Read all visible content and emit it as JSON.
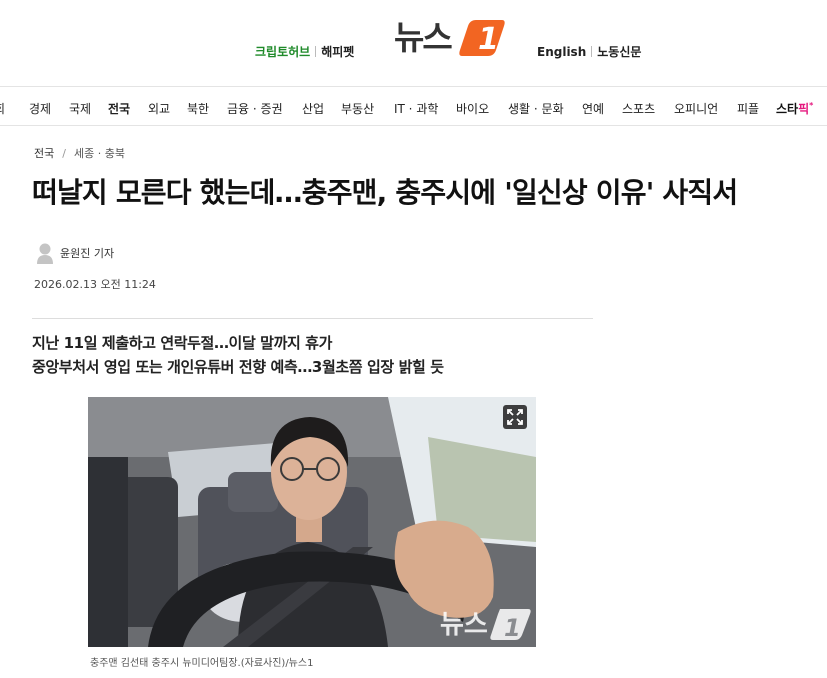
{
  "header": {
    "left_links": [
      "크립토허브",
      "해피펫"
    ],
    "logo_text": "뉴스",
    "logo_mark": "1",
    "right_links": [
      "English",
      "노동신문"
    ],
    "brand_color": "#f26522"
  },
  "nav": {
    "items": [
      {
        "label": "회",
        "active": false
      },
      {
        "label": "경제",
        "active": false
      },
      {
        "label": "국제",
        "active": false
      },
      {
        "label": "전국",
        "active": true
      },
      {
        "label": "외교",
        "active": false
      },
      {
        "label": "북한",
        "active": false
      },
      {
        "label": "금융 · 증권",
        "active": false
      },
      {
        "label": "산업",
        "active": false
      },
      {
        "label": "부동산",
        "active": false
      },
      {
        "label": "IT · 과학",
        "active": false
      },
      {
        "label": "바이오",
        "active": false
      },
      {
        "label": "생활 · 문화",
        "active": false
      },
      {
        "label": "연예",
        "active": false
      },
      {
        "label": "스포츠",
        "active": false
      },
      {
        "label": "오피니언",
        "active": false
      },
      {
        "label": "피플",
        "active": false
      }
    ],
    "star_label_a": "스타",
    "star_label_b": "픽",
    "star_mark": "*"
  },
  "article": {
    "breadcrumb": [
      "전국",
      "세종 · 충북"
    ],
    "title": "떠날지 모른다 했는데…충주맨, 충주시에 '일신상 이유' 사직서",
    "reporter": "윤원진 기자",
    "date": "2026.02.13 오전 11:24",
    "subheads": [
      "지난 11일 제출하고 연락두절…이달 말까지 휴가",
      "중앙부처서 영입 또는 개인유튜버 전향 예측…3월초쯤 입장 밝힐 듯"
    ],
    "photo_watermark": "뉴스",
    "photo_watermark_mark": "1",
    "caption": "충주맨 김선태 충주시 뉴미디어팀장.(자료사진)/뉴스1"
  }
}
